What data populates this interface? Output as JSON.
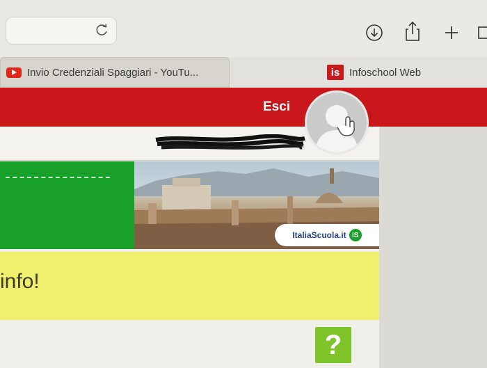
{
  "browser": {
    "tabs": [
      {
        "label": "Invio Credenziali Spaggiari - YouTu...",
        "icon": "youtube-icon"
      },
      {
        "label": "Infoschool Web",
        "icon": "infoschool-icon"
      }
    ],
    "toolbar_icons": [
      "reload-icon",
      "download-icon",
      "share-icon",
      "new-tab-icon",
      "tab-overview-icon"
    ]
  },
  "header": {
    "logout_label": "Esci",
    "accent_color": "#c8161a"
  },
  "user": {
    "avatar_icon": "user-avatar-icon",
    "name_redacted": true
  },
  "banner": {
    "brand_text": "ItaliaScuola.it",
    "brand_badge": "iS",
    "green_color": "#18a12a"
  },
  "info": {
    "text": "info!"
  },
  "help": {
    "label": "?"
  },
  "tab_logo_text": "is"
}
